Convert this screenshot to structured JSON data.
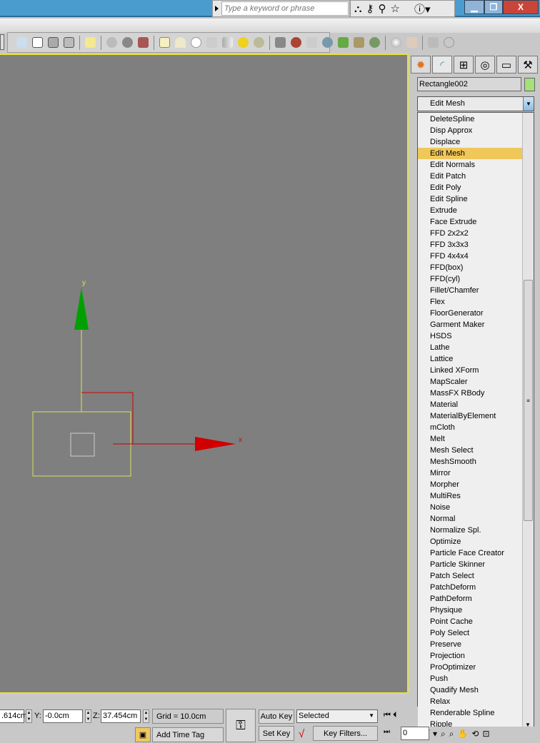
{
  "search": {
    "placeholder": "Type a keyword or phrase",
    "icons": [
      "binoculars-icon",
      "key-icon",
      "satellite-icon",
      "star-icon",
      "help-icon"
    ]
  },
  "window": {
    "minimize": "▁",
    "restore": "❐",
    "close": "X"
  },
  "command_panel": {
    "tabs": [
      "create",
      "modify",
      "hierarchy",
      "motion",
      "display",
      "utilities"
    ],
    "object_name": "Rectangle002",
    "object_color": "#a6e07a",
    "modifier_list_value": "Edit Mesh",
    "modifier_list_items": [
      "DeleteSpline",
      "Disp Approx",
      "Displace",
      "Edit Mesh",
      "Edit Normals",
      "Edit Patch",
      "Edit Poly",
      "Edit Spline",
      "Extrude",
      "Face Extrude",
      "FFD 2x2x2",
      "FFD 3x3x3",
      "FFD 4x4x4",
      "FFD(box)",
      "FFD(cyl)",
      "Fillet/Chamfer",
      "Flex",
      "FloorGenerator",
      "Garment Maker",
      "HSDS",
      "Lathe",
      "Lattice",
      "Linked XForm",
      "MapScaler",
      "MassFX RBody",
      "Material",
      "MaterialByElement",
      "mCloth",
      "Melt",
      "Mesh Select",
      "MeshSmooth",
      "Mirror",
      "Morpher",
      "MultiRes",
      "Noise",
      "Normal",
      "Normalize Spl.",
      "Optimize",
      "Particle Face Creator",
      "Particle Skinner",
      "Patch Select",
      "PatchDeform",
      "PathDeform",
      "Physique",
      "Point Cache",
      "Poly Select",
      "Preserve",
      "Projection",
      "ProOptimizer",
      "Push",
      "Quadify Mesh",
      "Relax",
      "Renderable Spline",
      "Ripple"
    ],
    "selected_index": 3
  },
  "viewport": {
    "axis_x": "x",
    "axis_y": "y"
  },
  "status": {
    "x_value": ".614cm",
    "y_label": "Y:",
    "y_value": "-0.0cm",
    "z_label": "Z:",
    "z_value": "37.454cm",
    "grid": "Grid = 10.0cm",
    "add_time_tag": "Add Time Tag",
    "auto_key": "Auto Key",
    "set_key": "Set Key",
    "selected": "Selected",
    "key_filters": "Key Filters...",
    "frame": "0"
  }
}
